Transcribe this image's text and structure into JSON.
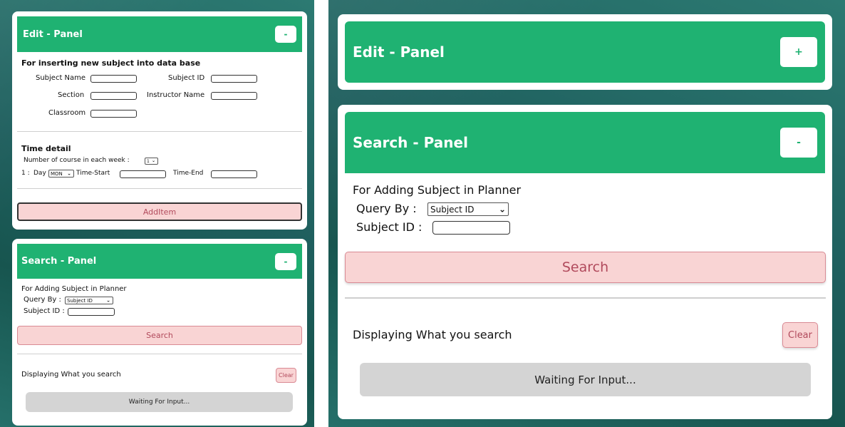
{
  "left": {
    "edit_panel": {
      "title": "Edit - Panel",
      "toggle": "-",
      "insert_heading": "For inserting new subject into data base",
      "fields": {
        "subject_name": "Subject Name",
        "subject_id": "Subject ID",
        "section": "Section",
        "instructor_name": "Instructor Name",
        "classroom": "Classroom"
      },
      "time_heading": "Time detail",
      "course_count_label": "Number of course in each week :",
      "course_count_value": "1",
      "row_index": "1 :",
      "day_label": "Day",
      "day_value": "MON",
      "time_start_label": "Time-Start",
      "time_end_label": "Time-End",
      "add_button": "AddItem"
    },
    "search_panel": {
      "title": "Search - Panel",
      "toggle": "-",
      "heading": "For Adding Subject in Planner",
      "query_label": "Query By :",
      "query_value": "Subject ID",
      "subject_id_label": "Subject ID :",
      "search_button": "Search",
      "display_label": "Displaying What you search",
      "clear_button": "Clear",
      "waiting": "Waiting For Input..."
    }
  },
  "right": {
    "edit_panel": {
      "title": "Edit - Panel",
      "toggle": "+"
    },
    "search_panel": {
      "title": "Search - Panel",
      "toggle": "-",
      "heading": "For Adding Subject in Planner",
      "query_label": "Query By :",
      "query_value": "Subject ID",
      "subject_id_label": "Subject ID :",
      "search_button": "Search",
      "display_label": "Displaying What you search",
      "clear_button": "Clear",
      "waiting": "Waiting For Input..."
    }
  },
  "colors": {
    "header_green": "#1fb272",
    "button_pink": "#f9d4d4",
    "button_text": "#b14a5c",
    "waiting_grey": "#d4d4d4"
  },
  "icons": {
    "dropdown": "chevron-down-icon"
  }
}
